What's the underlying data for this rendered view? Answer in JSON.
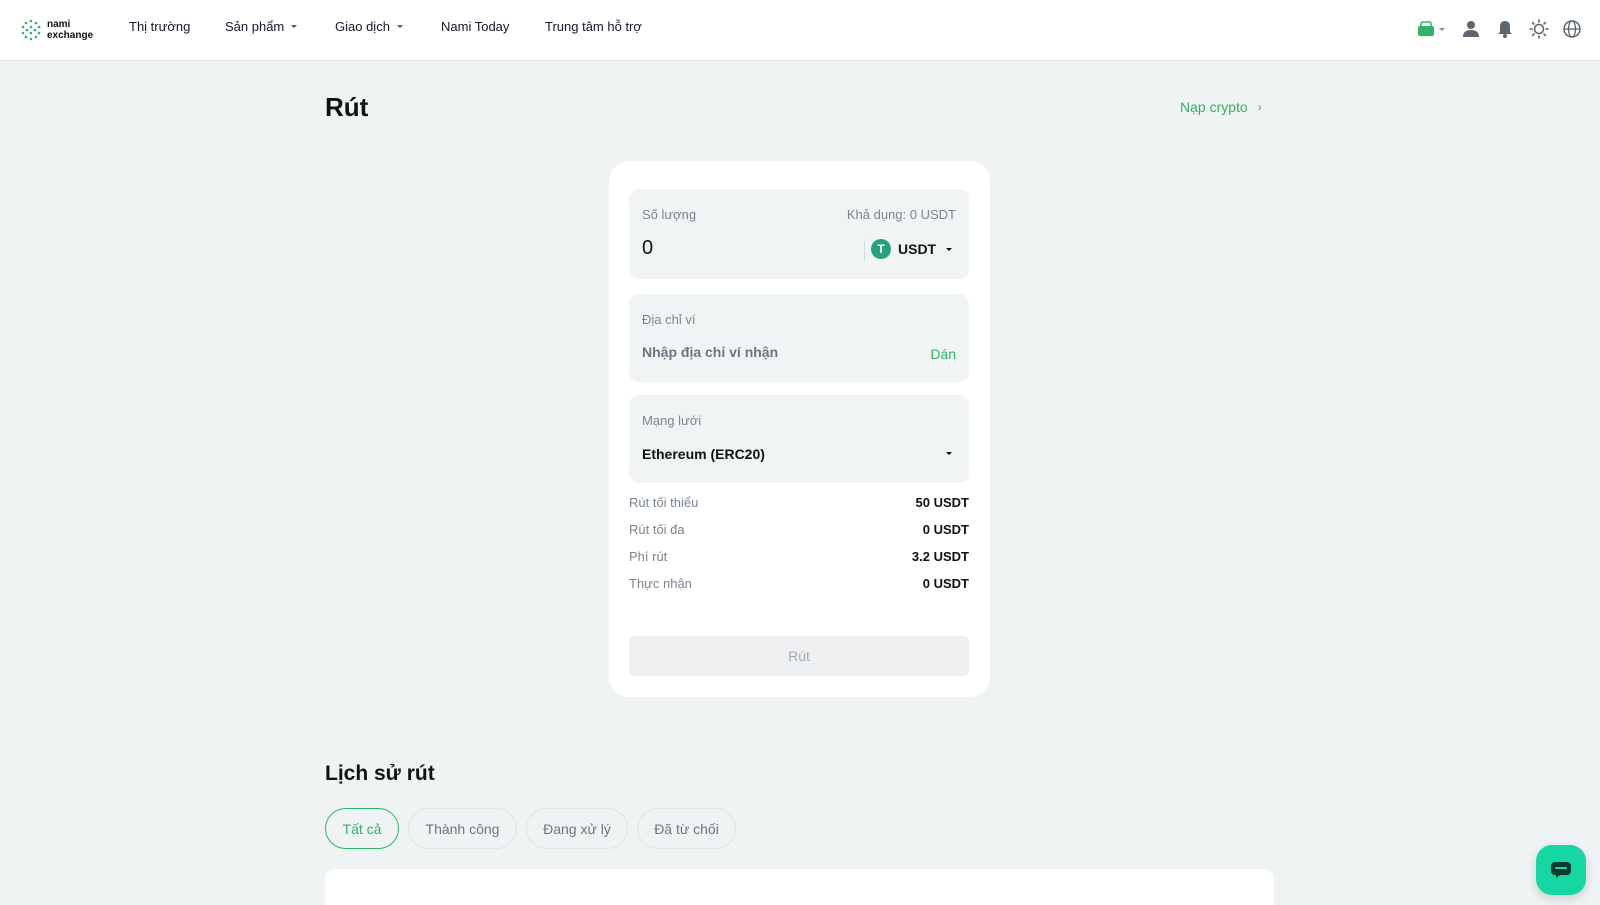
{
  "brand": {
    "line1": "nami",
    "line2": "exchange",
    "icon": "nami-logo-icon"
  },
  "nav": {
    "market": "Thị trường",
    "products": "Sản phẩm",
    "trade": "Giao dịch",
    "nami_today": "Nami Today",
    "support": "Trung tâm hỗ trợ"
  },
  "header_icons": [
    "wallet-icon",
    "user-icon",
    "bell-icon",
    "theme-sun-icon",
    "globe-icon"
  ],
  "page": {
    "title": "Rút",
    "deposit_link": "Nạp crypto"
  },
  "form": {
    "amount_label": "Số lượng",
    "available": "Khả dụng: 0 USDT",
    "amount_value": "0",
    "coin": "USDT",
    "address_label": "Địa chỉ ví",
    "address_placeholder": "Nhập địa chỉ ví nhận",
    "paste": "Dán",
    "network_label": "Mạng lưới",
    "network_value": "Ethereum (ERC20)",
    "min_label": "Rút tối thiểu",
    "min_value": "50 USDT",
    "max_label": "Rút tối đa",
    "max_value": "0 USDT",
    "fee_label": "Phí rút",
    "fee_value": "3.2 USDT",
    "receive_label": "Thực nhận",
    "receive_value": "0 USDT",
    "submit": "Rút"
  },
  "history": {
    "title": "Lịch sử rút",
    "tabs": [
      "Tất cả",
      "Thành công",
      "Đang xử lý",
      "Đã từ chối"
    ],
    "active_tab": 0
  },
  "colors": {
    "accent": "#2fb36b",
    "chat": "#14d7a4",
    "tether": "#26a17b"
  }
}
